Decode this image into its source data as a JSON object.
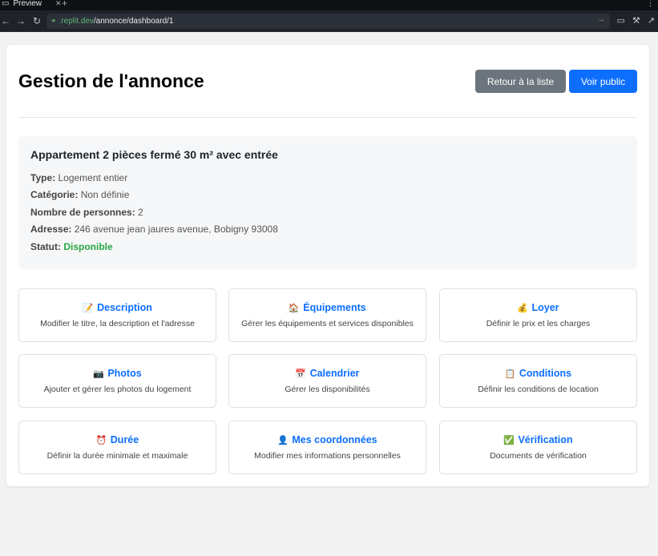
{
  "browser": {
    "tab_title": "Preview",
    "url_host": ".replit.dev",
    "url_path": "/annonce/dashboard/1"
  },
  "header": {
    "title": "Gestion de l'annonce",
    "back_label": "Retour à la liste",
    "public_label": "Voir public"
  },
  "listing": {
    "title": "Appartement 2 pièces fermé 30 m² avec entrée",
    "type_label": "Type:",
    "type_value": "Logement entier",
    "category_label": "Catégorie:",
    "category_value": "Non définie",
    "persons_label": "Nombre de personnes:",
    "persons_value": "2",
    "address_label": "Adresse:",
    "address_value": "246 avenue jean jaures avenue, Bobigny 93008",
    "status_label": "Statut:",
    "status_value": "Disponible"
  },
  "tiles": [
    {
      "icon": "📝",
      "icon_name": "memo-icon",
      "title": "Description",
      "desc": "Modifier le titre, la description et l'adresse"
    },
    {
      "icon": "🏠",
      "icon_name": "house-icon",
      "title": "Équipements",
      "desc": "Gérer les équipements et services disponibles"
    },
    {
      "icon": "💰",
      "icon_name": "money-bag-icon",
      "title": "Loyer",
      "desc": "Définir le prix et les charges"
    },
    {
      "icon": "📷",
      "icon_name": "camera-icon",
      "title": "Photos",
      "desc": "Ajouter et gérer les photos du logement"
    },
    {
      "icon": "📅",
      "icon_name": "calendar-icon",
      "title": "Calendrier",
      "desc": "Gérer les disponibilités"
    },
    {
      "icon": "📋",
      "icon_name": "clipboard-icon",
      "title": "Conditions",
      "desc": "Définir les conditions de location"
    },
    {
      "icon": "⏰",
      "icon_name": "alarm-clock-icon",
      "title": "Durée",
      "desc": "Définir la durée minimale et maximale"
    },
    {
      "icon": "👤",
      "icon_name": "user-icon",
      "title": "Mes coordonnées",
      "desc": "Modifier mes informations personnelles"
    },
    {
      "icon": "✅",
      "icon_name": "check-mark-icon",
      "title": "Vérification",
      "desc": "Documents de vérification"
    }
  ]
}
